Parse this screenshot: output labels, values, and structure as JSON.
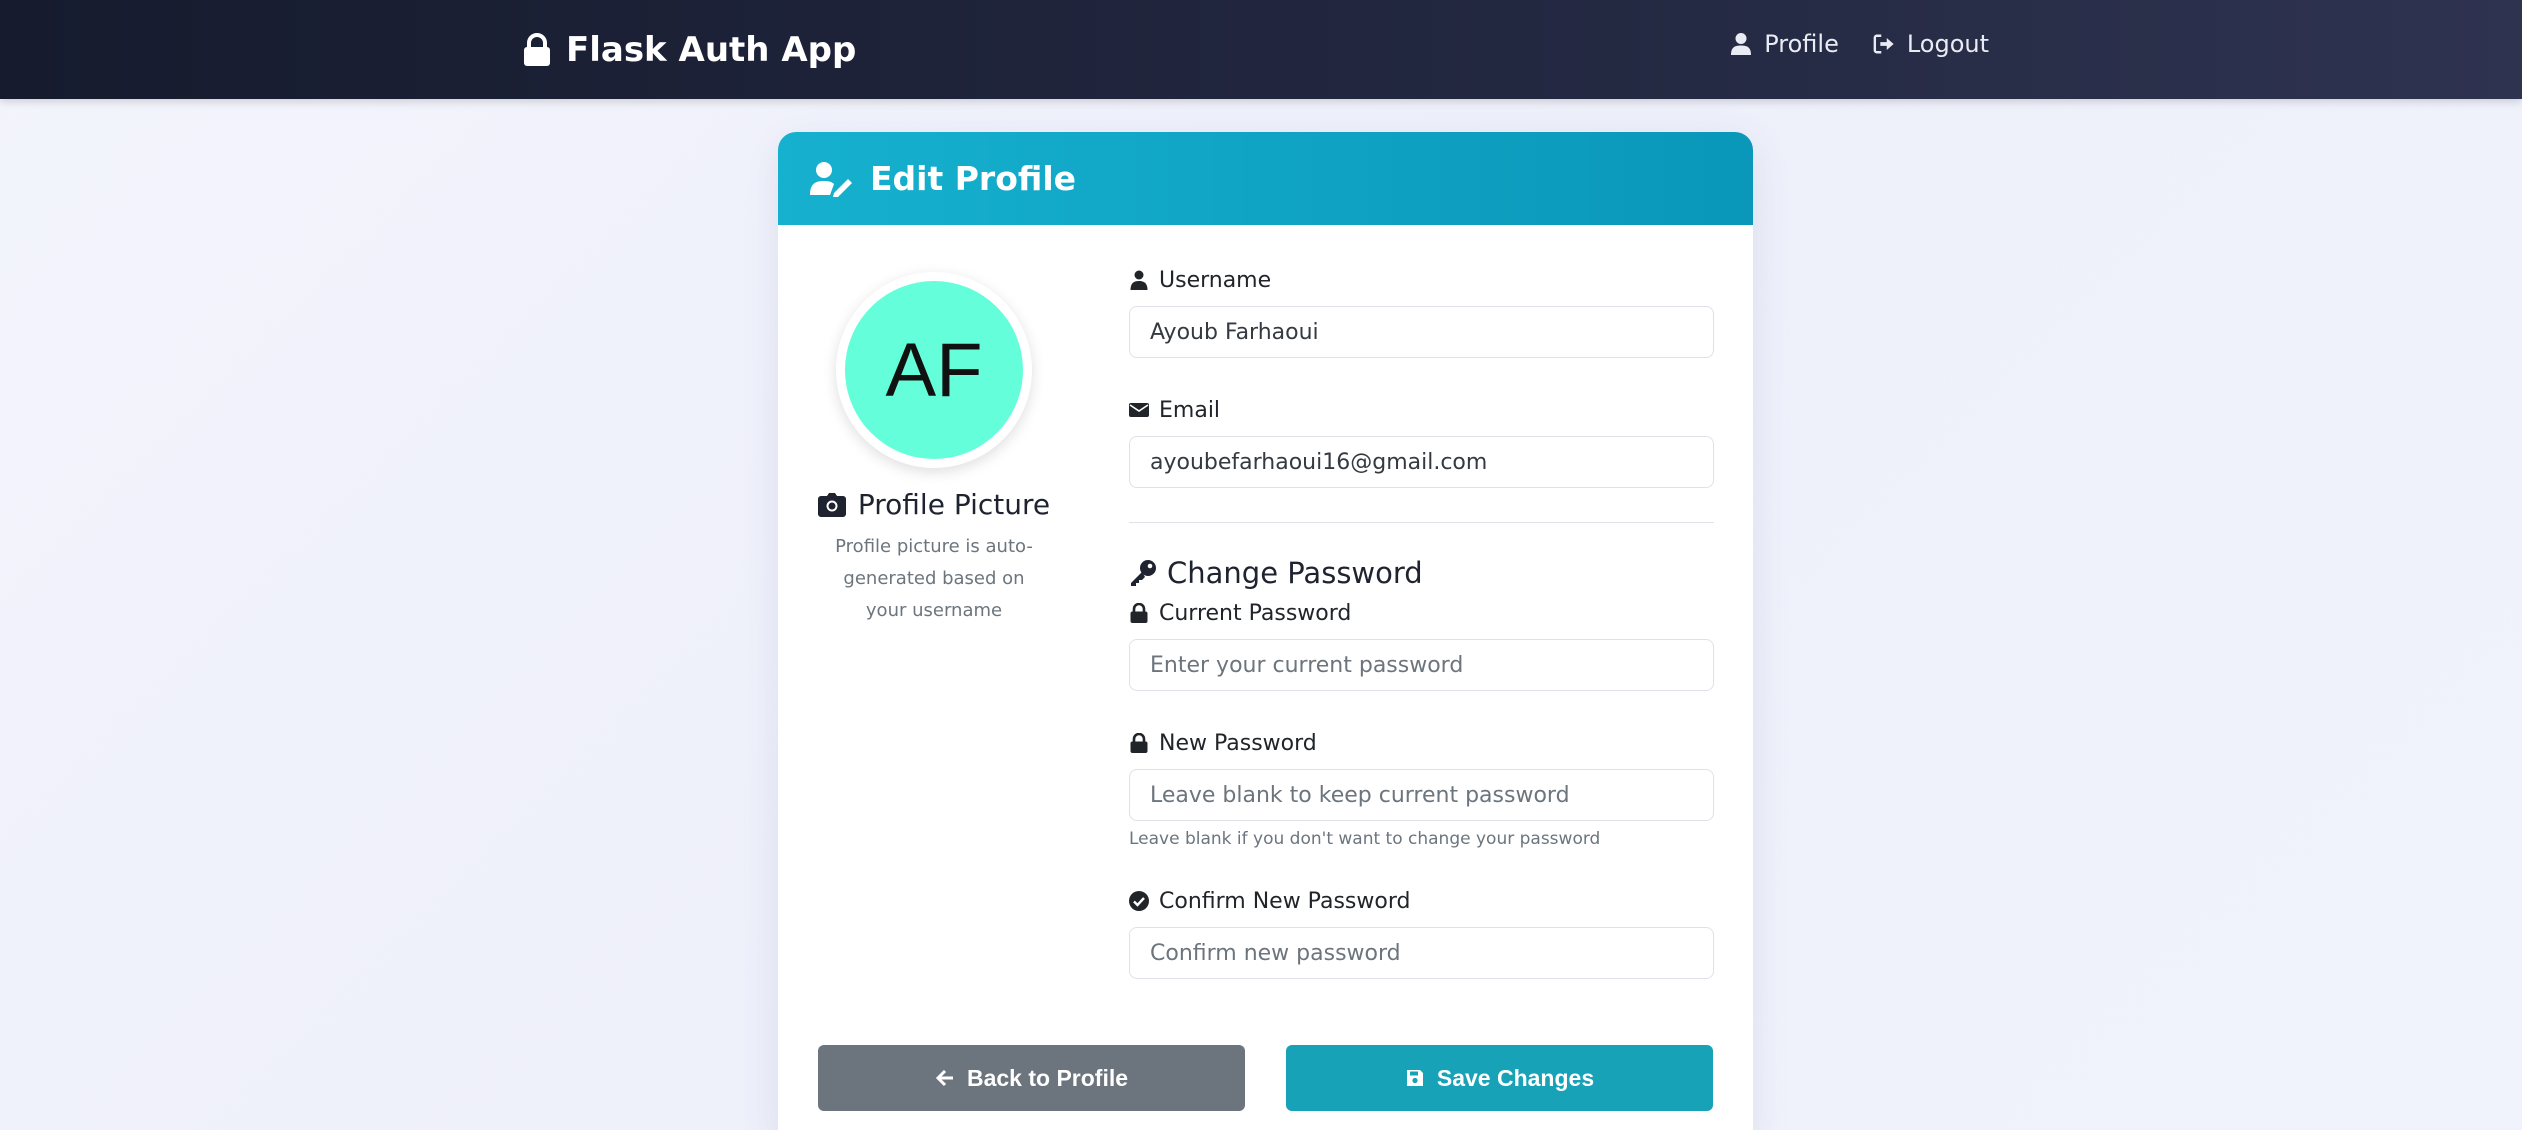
{
  "nav": {
    "brand": "Flask Auth App",
    "links": [
      {
        "label": "Profile",
        "icon": "user-icon"
      },
      {
        "label": "Logout",
        "icon": "logout-icon"
      }
    ]
  },
  "card": {
    "title": "Edit Profile",
    "avatar_initials": "AF",
    "avatar_color": "#64ffda",
    "picture_title": "Profile Picture",
    "picture_help": "Profile picture is auto-generated based on your username"
  },
  "form": {
    "username": {
      "label": "Username",
      "value": "Ayoub Farhaoui"
    },
    "email": {
      "label": "Email",
      "value": "ayoubefarhaoui16@gmail.com"
    },
    "change_password_title": "Change Password",
    "current_password": {
      "label": "Current Password",
      "placeholder": "Enter your current password"
    },
    "new_password": {
      "label": "New Password",
      "placeholder": "Leave blank to keep current password",
      "hint": "Leave blank if you don't want to change your password"
    },
    "confirm_password": {
      "label": "Confirm New Password",
      "placeholder": "Confirm new password"
    }
  },
  "buttons": {
    "back": "Back to Profile",
    "save": "Save Changes"
  },
  "colors": {
    "header_gradient_start": "#16b1cf",
    "header_gradient_end": "#0a97b9",
    "save_button": "#17a2b8",
    "back_button": "#6c757d",
    "navbar": "#1b2034"
  }
}
